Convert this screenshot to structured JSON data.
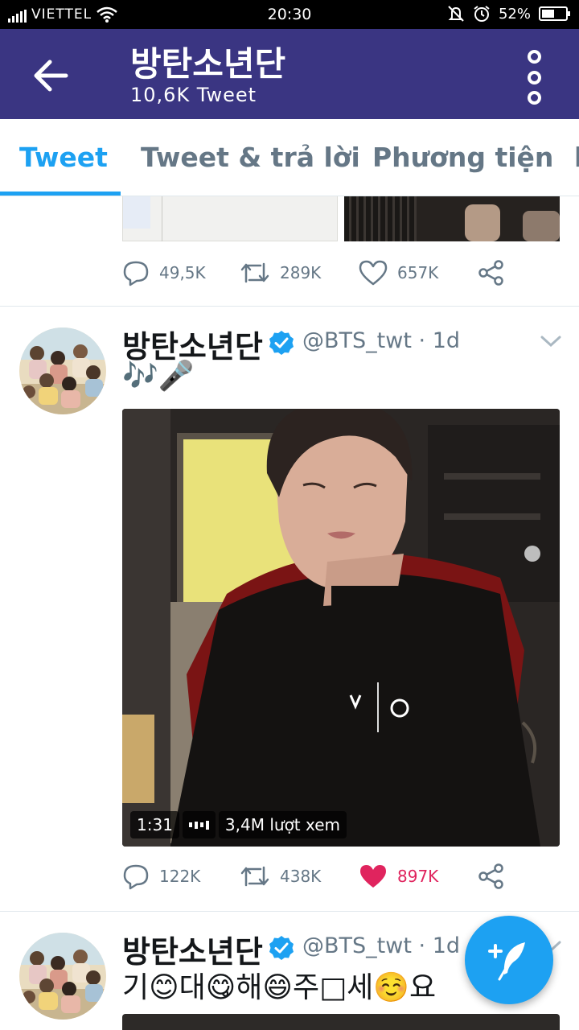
{
  "status_bar": {
    "carrier": "VIETTEL",
    "time": "20:30",
    "battery_percent": "52%",
    "battery_level": 0.52,
    "icons": [
      "signal-icon",
      "wifi-icon",
      "silent-icon",
      "alarm-icon",
      "battery-icon"
    ]
  },
  "header": {
    "title": "방탄소년단",
    "subtitle": "10,6K Tweet",
    "back_icon": "arrow-left-icon",
    "menu_icon": "kebab-menu-icon",
    "background": "#3a3582"
  },
  "tabs": [
    {
      "label": "Tweet",
      "active": true
    },
    {
      "label": "Tweet & trả lời",
      "active": false
    },
    {
      "label": "Phương tiện",
      "active": false
    }
  ],
  "accent": "#1da1f2",
  "like_color": "#e0245e",
  "tweets": [
    {
      "actions": {
        "replies": "49,5K",
        "retweets": "289K",
        "likes": "657K",
        "liked": false
      }
    },
    {
      "display_name": "방탄소년단",
      "handle": "@BTS_twt",
      "separator": "·",
      "age": "1d",
      "text": "🎶🎤",
      "video": {
        "duration": "1:31",
        "views": "3,4M lượt xem"
      },
      "actions": {
        "replies": "122K",
        "retweets": "438K",
        "likes": "897K",
        "liked": true
      }
    },
    {
      "display_name": "방탄소년단",
      "handle": "@BTS_twt",
      "separator": "·",
      "age": "1d",
      "text": "기😊대😋해😄주□세☺️요"
    }
  ],
  "fab": {
    "icon": "compose-tweet-icon"
  }
}
